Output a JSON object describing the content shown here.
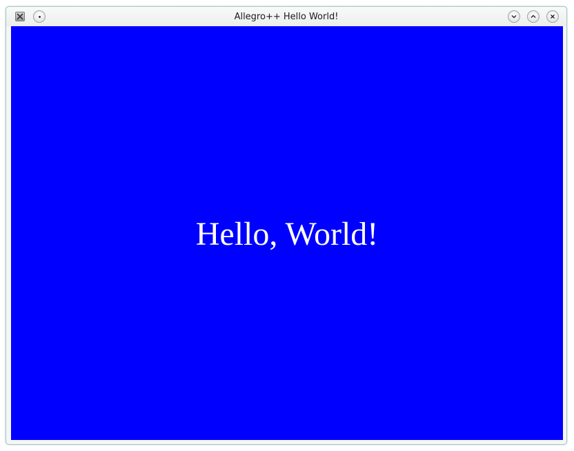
{
  "window": {
    "title": "Allegro++ Hello World!"
  },
  "titlebar": {
    "app_icon": "x-window-icon",
    "menu_icon": "window-menu-dot-icon",
    "minimize_icon": "chevron-down-icon",
    "maximize_icon": "chevron-up-icon",
    "close_icon": "close-icon"
  },
  "canvas": {
    "background_color": "#0000ff",
    "text_color": "#ffffff",
    "message": "Hello, World!"
  }
}
